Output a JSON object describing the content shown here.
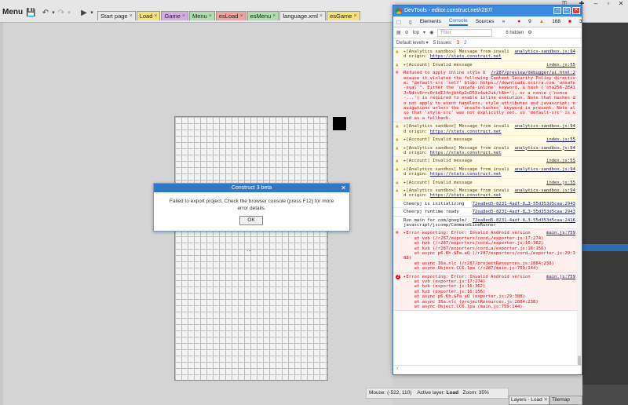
{
  "topbar": {
    "menu_label": "Menu",
    "tabs": [
      {
        "label": "Start page",
        "color": "#e8e8e8"
      },
      {
        "label": "Load",
        "color": "#f5e07a"
      },
      {
        "label": "Game",
        "color": "#d8a8e8"
      },
      {
        "label": "Menu",
        "color": "#a8e0a8"
      },
      {
        "label": "esLoad",
        "color": "#f0a0a0"
      },
      {
        "label": "esMenu",
        "color": "#a8e0a8"
      },
      {
        "label": "language.xml",
        "color": "#e8e8e8"
      },
      {
        "label": "esGame",
        "color": "#f5e07a"
      }
    ],
    "tab_close": "×"
  },
  "status": {
    "mouse_label": "Mouse:",
    "mouse_value": "(-522, 110)",
    "layer_label": "Active layer:",
    "layer_value": "Load",
    "zoom_label": "Zoom:",
    "zoom_value": "35%"
  },
  "layers_tab": "Layers - Load",
  "tilemap_tab": "Tilemap",
  "canvas_dots": "...",
  "dialog": {
    "title": "Construct 3 beta",
    "message": "Failed to export project. Check the browser console (press F12) for more error details.",
    "ok_label": "OK",
    "close": "✕"
  },
  "devtools": {
    "title": "DevTools - editor.construct.net/r287/",
    "tabs": {
      "elements": "Elements",
      "console": "Console",
      "sources": "Sources",
      "more": "»"
    },
    "counts": {
      "errors": "9",
      "warnings": "168",
      "messages": "3"
    },
    "context": "top",
    "filter_placeholder": "Filter",
    "hidden": "6 hidden",
    "levels": "Default levels ▾",
    "issues": "5 Issues:",
    "issues_err": "3",
    "issues_warn": "2",
    "prompt": "›",
    "log": [
      {
        "type": "warn",
        "text": "▸[Analytics sandbox] Message from invalid origin: ",
        "link": "https://stats.construct.net",
        "src": "analytics-sandbox.js:94"
      },
      {
        "type": "warn",
        "text": "▸[Account] Invalid message",
        "link": "",
        "src": "index.js:55"
      },
      {
        "type": "err",
        "text": "Refused to apply inline style because it violates the following Content Security Policy directive: \"default-src 'self' blob: https://downloads.scirra.com 'unsafe-eval'\". Either the 'unsafe-inline' keyword, a hash ('sha256-2EA1J+9d+s6rrc0rkdIJfmjbh6p2oD5Xs4wb2uk/tAk='), or a nonce ('nonce-...') is required to enable inline execution. Note that hashes do not apply to event handlers, style attributes and javascript: navigations unless the 'unsafe-hashes' keyword is present. Note also that 'style-src' was not explicitly set, so 'default-src' is used as a fallback.",
        "link": "",
        "src": "/r287/preview/debugger/ui.html:2"
      },
      {
        "type": "warn",
        "text": "▸[Analytics sandbox] Message from invalid origin: ",
        "link": "https://stats.construct.net",
        "src": "analytics-sandbox.js:94"
      },
      {
        "type": "warn",
        "text": "▸[Account] Invalid message",
        "link": "",
        "src": "index.js:55"
      },
      {
        "type": "warn",
        "text": "▸[Analytics sandbox] Message from invalid origin: ",
        "link": "https://stats.construct.net",
        "src": "analytics-sandbox.js:94"
      },
      {
        "type": "warn",
        "text": "▸[Account] Invalid message",
        "link": "",
        "src": "index.js:55"
      },
      {
        "type": "warn",
        "text": "▸[Analytics sandbox] Message from invalid origin: ",
        "link": "https://stats.construct.net",
        "src": "analytics-sandbox.js:94"
      },
      {
        "type": "warn",
        "text": "▸[Account] Invalid message",
        "link": "",
        "src": "index.js:55"
      },
      {
        "type": "warn",
        "text": "▸[Analytics sandbox] Message from invalid origin: ",
        "link": "https://stats.construct.net",
        "src": "analytics-sandbox.js:94"
      },
      {
        "type": "info",
        "text": "Cheerpj is initializing",
        "link": "",
        "src": "72ea8ed5-8231-4adf-8…3-55d353d5caa:2943"
      },
      {
        "type": "info",
        "text": "Cheerpj runtime ready",
        "link": "",
        "src": "72ea8ed5-8231-4adf-8…3-55d353d5caa:2943"
      },
      {
        "type": "info",
        "text": "Run main for com/google/javascript/jscomp/CommandLineRunner",
        "link": "",
        "src": "72ea8ed5-8231-4adf-8…3-55d353d5caa:2416"
      },
      {
        "type": "err",
        "text": "▸Error exporting: Error: Invalid Android version\n    at vvb (/r287/exporters/cord…/exporter.js:17:274)\n    at hvb (/r287/exporters/cord…/exporter.js:16:362)\n    at kvb (/r287/exporters/cord…a/exporter.js:16:156)\n    at async p6.Kh.$Pa.aQ (/r287/exporters/cord…/exporter.js:29:388)\n    at async I6a.nlc (/r287/projectResources.js:2884:238)\n    at async Object.CC6.lpa (/r287/main.js:759:144)",
        "link": "",
        "src": "main.js:759"
      },
      {
        "type": "err",
        "text": "▸Error exporting: Error: Invalid Android version\n    at vvb (exporter.js:17:274)\n    at hvb (exporter.js:16:362)\n    at kvb (exporter.js:16:156)\n    at async p6.Kh.$Pa.aQ (exporter.js:29:388)\n    at async I6a.nlc (projectResources.js:2884:238)\n    at async Object.CC6.lpa (main.js:759:144)",
        "link": "",
        "src": "main.js:759",
        "badge": "2"
      }
    ]
  }
}
